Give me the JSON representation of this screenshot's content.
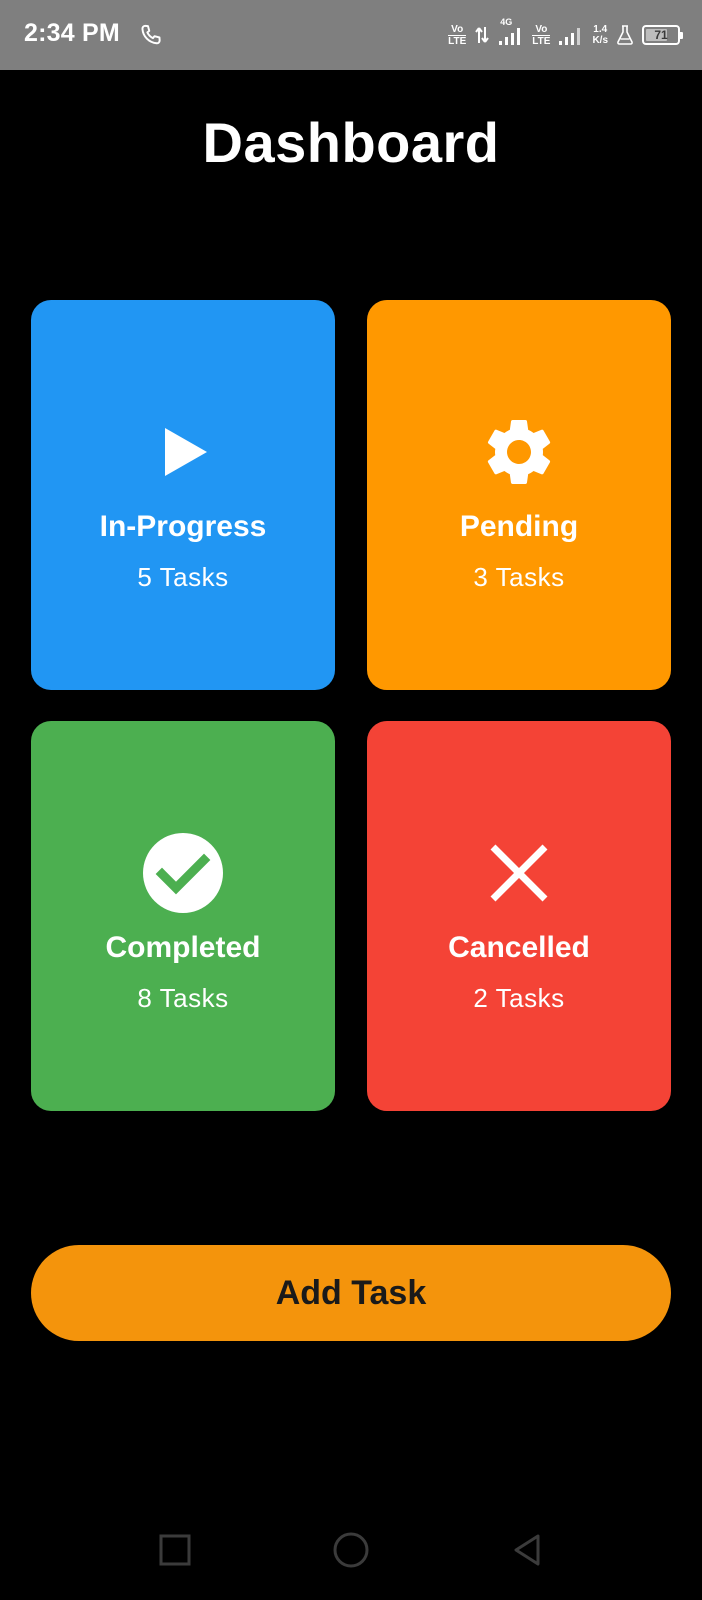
{
  "status_bar": {
    "time": "2:34 PM",
    "volte_top": "Vo",
    "volte_bottom": "LTE",
    "network_type": "4G",
    "speed_value": "1.4",
    "speed_unit": "K/s",
    "battery_level": "71",
    "battery_fraction": 0.71,
    "icons": [
      "call-icon",
      "volte-icon",
      "data-arrows-icon",
      "signal-icon",
      "signal-icon",
      "flask-icon",
      "battery-icon"
    ]
  },
  "header": {
    "title": "Dashboard"
  },
  "cards": [
    {
      "label": "In-Progress",
      "count": "5 Tasks",
      "icon": "play-icon",
      "color": "#2196F3"
    },
    {
      "label": "Pending",
      "count": "3 Tasks",
      "icon": "gear-icon",
      "color": "#FF9800"
    },
    {
      "label": "Completed",
      "count": "8 Tasks",
      "icon": "check-circle-icon",
      "color": "#4CAF50"
    },
    {
      "label": "Cancelled",
      "count": "2 Tasks",
      "icon": "close-icon",
      "color": "#F44336"
    }
  ],
  "actions": {
    "add_task_label": "Add Task",
    "add_task_color": "#F4940C"
  },
  "nav_bar": {
    "icons": [
      "recents-icon",
      "home-icon",
      "back-icon"
    ],
    "color": "#3b3b3b"
  },
  "theme": {
    "background": "#000000",
    "status_bar_background": "#7F7F7F",
    "text": "#FFFFFF"
  }
}
